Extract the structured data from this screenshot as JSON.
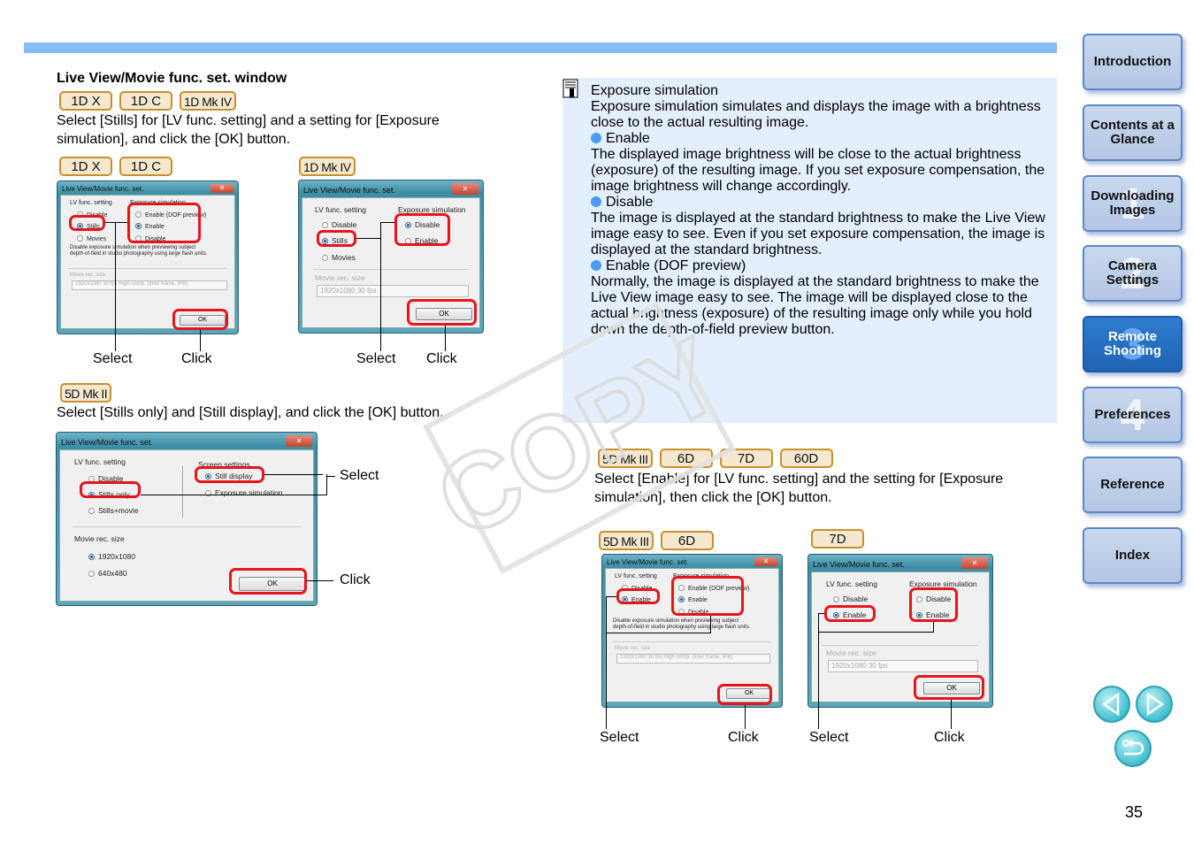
{
  "left": {
    "section_title": "Live View/Movie func. set. window",
    "block1": {
      "tags": [
        "1D X",
        "1D C",
        "1D Mk IV"
      ],
      "instruction": "Select [Stills] for [LV func. setting] and a setting for [Exposure simulation], and click the [OK] button.",
      "dialogA": {
        "tags": [
          "1D X",
          "1D C"
        ],
        "title": "Live View/Movie func. set.",
        "lv_label": "LV func. setting",
        "lv_options": [
          "Disable",
          "Stills",
          "Movies"
        ],
        "lv_selected": "Stills",
        "exp_label": "Exposure simulation",
        "exp_options": [
          "Enable (DOF preview)",
          "Enable",
          "Disable"
        ],
        "exp_selected": "Enable",
        "note_line1": "Disable exposure simulation when previewing subject",
        "note_line2": "depth-of-field in studio photography using large flash units.",
        "movie_label": "Movie rec. size",
        "movie_value": "1920x1080 30 fps High comp. (Inter frame, IPB)",
        "ok": "OK",
        "captions": [
          "Select",
          "Click"
        ]
      },
      "dialogB": {
        "tags": [
          "1D Mk IV"
        ],
        "title": "Live View/Movie func. set.",
        "lv_label": "LV func. setting",
        "lv_options": [
          "Disable",
          "Stills",
          "Movies"
        ],
        "lv_selected": "Stills",
        "exp_label": "Exposure simulation",
        "exp_options": [
          "Disable",
          "Enable"
        ],
        "exp_selected": "Disable",
        "movie_label": "Movie rec. size",
        "movie_value": "1920x1080  30 fps",
        "ok": "OK",
        "captions": [
          "Select",
          "Click"
        ]
      }
    },
    "block2": {
      "tags": [
        "5D Mk II"
      ],
      "instruction": "Select [Stills only] and [Still display], and click the [OK] button.",
      "dialog": {
        "title": "Live View/Movie func. set.",
        "lv_label": "LV func. setting",
        "lv_options": [
          "Disable",
          "Stills only",
          "Stills+movie"
        ],
        "lv_selected": "Stills only",
        "screen_label": "Screen settings",
        "screen_options": [
          "Still display",
          "Exposure simulation"
        ],
        "screen_selected": "Still display",
        "movie_label": "Movie rec. size",
        "movie_options": [
          "1920x1080",
          "640x480"
        ],
        "movie_selected": "1920x1080",
        "ok": "OK",
        "captions": [
          "Select",
          "Click"
        ]
      }
    }
  },
  "note": {
    "title": "Exposure simulation",
    "intro": "Exposure simulation simulates and displays the image with a brightness close to the actual resulting image.",
    "items": [
      {
        "label": "Enable",
        "text": "The displayed image brightness will be close to the actual brightness (exposure) of the resulting image. If you set exposure compensation, the image brightness will change accordingly."
      },
      {
        "label": "Disable",
        "text": "The image is displayed at the standard brightness to make the Live View image easy to see. Even if you set exposure compensation, the image is displayed at the standard brightness."
      },
      {
        "label": "Enable (DOF preview)",
        "text": "Normally, the image is displayed at the standard brightness to make the Live View image easy to see. The image will be displayed close to the actual brightness (exposure) of the resulting image only while you hold down the depth-of-field preview button."
      }
    ]
  },
  "right": {
    "tags": [
      "5D Mk III",
      "6D",
      "7D",
      "60D"
    ],
    "instruction": "Select [Enable] for [LV func. setting] and the setting for [Exposure simulation], then click the [OK] button.",
    "dialogC": {
      "tags": [
        "5D Mk III",
        "6D"
      ],
      "title": "Live View/Movie func. set.",
      "lv_label": "LV func. setting",
      "lv_options": [
        "Disable",
        "Enable"
      ],
      "lv_selected": "Enable",
      "exp_label": "Exposure simulation",
      "exp_options": [
        "Enable (DOF preview)",
        "Enable",
        "Disable"
      ],
      "exp_selected": "Enable",
      "note_line1": "Disable exposure simulation when previewing subject",
      "note_line2": "depth-of-field in studio photography using large flash units.",
      "movie_label": "Movie rec. size",
      "movie_value": "1920x1080 30 fps High comp. (Inter frame, IPB)",
      "ok": "OK",
      "captions": [
        "Select",
        "Click"
      ]
    },
    "dialogD": {
      "tags": [
        "7D"
      ],
      "title": "Live View/Movie func. set.",
      "lv_label": "LV func. setting",
      "lv_options": [
        "Disable",
        "Enable"
      ],
      "lv_selected": "Enable",
      "exp_label": "Exposure simulation",
      "exp_options": [
        "Disable",
        "Enable"
      ],
      "exp_selected": "Enable",
      "movie_label": "Movie rec. size",
      "movie_value": "1920x1080  30 fps",
      "ok": "OK",
      "captions": [
        "Select",
        "Click"
      ]
    }
  },
  "nav": {
    "items": [
      {
        "label": "Introduction",
        "num": ""
      },
      {
        "label": "Contents at a Glance",
        "num": ""
      },
      {
        "label": "Downloading Images",
        "num": "1"
      },
      {
        "label": "Camera Settings",
        "num": "2"
      },
      {
        "label": "Remote Shooting",
        "num": "3",
        "active": true
      },
      {
        "label": "Preferences",
        "num": "4"
      },
      {
        "label": "Reference",
        "num": ""
      },
      {
        "label": "Index",
        "num": ""
      }
    ],
    "prev_icon": "prev-page-icon",
    "next_icon": "next-page-icon",
    "back_icon": "return-icon"
  },
  "watermark": "COPY",
  "page_number": "35",
  "colors": {
    "accent_bar": "#84bdfa",
    "note_bg": "#e3effc",
    "highlight": "#e8141c",
    "tag_border": "#c8902c",
    "nav_active": "#1f63b4"
  }
}
